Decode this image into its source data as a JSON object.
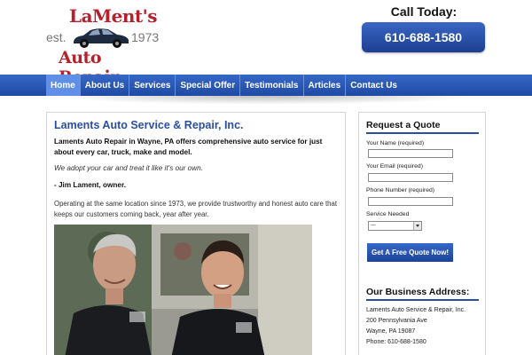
{
  "header": {
    "logo": {
      "line1": "LaMent's",
      "est": "est.",
      "year": "1973",
      "line2": "Auto Repair"
    },
    "call_label": "Call Today:",
    "phone": "610-688-1580"
  },
  "nav": {
    "items": [
      {
        "label": "Home"
      },
      {
        "label": "About Us"
      },
      {
        "label": "Services"
      },
      {
        "label": "Special Offer"
      },
      {
        "label": "Testimonials"
      },
      {
        "label": "Articles"
      },
      {
        "label": "Contact Us"
      }
    ],
    "active_index": 0
  },
  "main": {
    "title": "Laments Auto Service & Repair, Inc.",
    "intro_bold": "Laments Auto Repair in Wayne, PA offers comprehensive auto service for just about every car, truck, make and model.",
    "tagline": "We adopt your car and treat it like it's our own.",
    "signature": "- Jim Lament, owner.",
    "body": "Operating at the same location since 1973, we provide trustworthy and honest auto care that keeps our customers coming back, year after year."
  },
  "sidebar": {
    "quote_title": "Request a Quote",
    "fields": {
      "name_label": "Your Name (required)",
      "email_label": "Your Email (required)",
      "phone_label": "Phone Number (required)",
      "service_label": "Service Needed",
      "service_selected": "---"
    },
    "quote_button": "Get A Free Quote Now!",
    "address_title": "Our Business Address:",
    "address": {
      "name": "Laments Auto Service & Repair, Inc.",
      "street": "200 Pennsylvania Ave",
      "city": "Wayne, PA 19087",
      "phone": "Phone: 610-688-1580"
    }
  },
  "colors": {
    "brand_red": "#b5202a",
    "nav_blue": "#2a57b5",
    "heading_blue": "#2a4fa0",
    "button_blue": "#1d439a"
  }
}
